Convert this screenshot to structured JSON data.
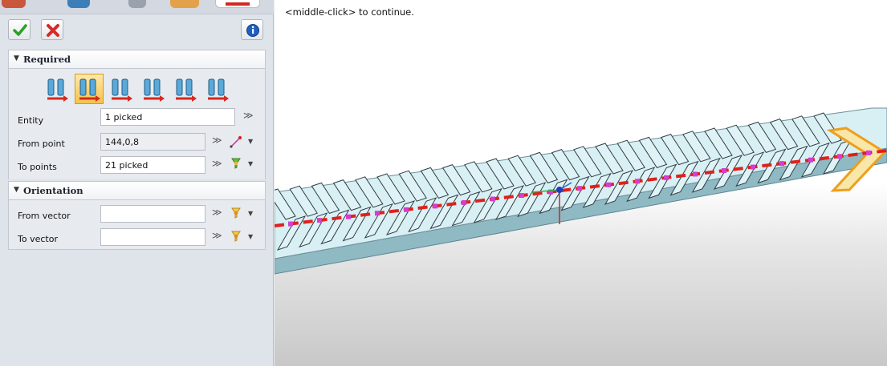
{
  "actions": {
    "ok": "ok-checkmark",
    "cancel": "cancel-x",
    "info": "info-icon"
  },
  "required": {
    "title": "Required",
    "type_buttons": [
      "align-type-1",
      "align-type-2",
      "align-type-3",
      "align-type-4",
      "align-type-5",
      "align-type-6"
    ],
    "selected_type_index": 1,
    "entity_label": "Entity",
    "entity_value": "1 picked",
    "from_point_label": "From point",
    "from_point_value": "144,0,8",
    "to_points_label": "To points",
    "to_points_value": "21 picked"
  },
  "orientation": {
    "title": "Orientation",
    "from_vector_label": "From vector",
    "from_vector_value": "",
    "to_vector_label": "To vector",
    "to_vector_value": ""
  },
  "viewport": {
    "prompt": "<middle-click> to continue."
  },
  "colors": {
    "accent_selected": "#f6c34b",
    "path_red": "#e0201b",
    "part_face": "#d6eef3"
  }
}
